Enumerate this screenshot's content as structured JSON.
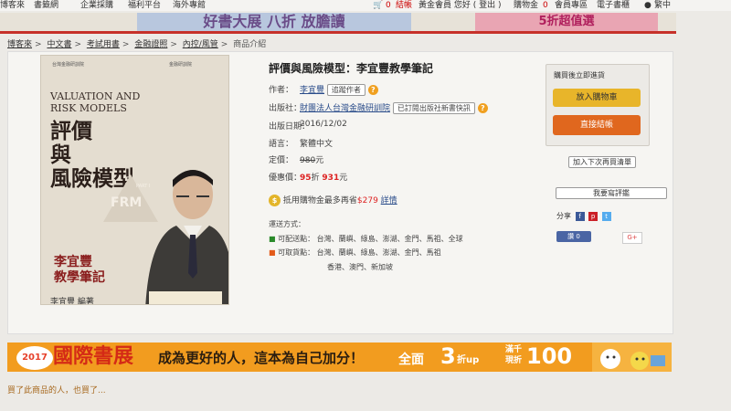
{
  "topnav": {
    "left": [
      "博客來",
      "書籤網",
      "企業採購",
      "福利平台",
      "海外專館"
    ],
    "checkout_count": "0",
    "checkout_label": "結帳",
    "greeting": "黃金會員 您好 ( 登出 )",
    "cart_label": "購物金",
    "cart_count": "0",
    "member": "會員專區",
    "ebook": "電子書櫃",
    "lang": "繁中"
  },
  "banner": {
    "center": "好書大展 八折 放膽讀",
    "right": "5折超值選"
  },
  "breadcrumb": [
    "博客來",
    "中文書",
    "考試用書",
    "金融證照",
    "內控/風管",
    "商品介紹"
  ],
  "cover": {
    "publisher_logo": "台灣金融研訓院",
    "publisher_logo2": "金融研訓院",
    "en_title_1": "VALUATION AND",
    "en_title_2": "RISK MODELS",
    "zh_title_1": "評價",
    "zh_title_2": "與",
    "zh_title_3": "風險模型",
    "part": "PART I",
    "frm": "FRM",
    "author_1": "李宜豐",
    "author_2": "教學筆記",
    "sign": "李宜豐 編著"
  },
  "product": {
    "title": "評價與風險模型：李宜豐教學筆記",
    "author_label": "作者：",
    "author": "李宜豐",
    "follow_label": "追蹤作者",
    "publisher_label": "出版社：",
    "publisher": "財團法人台灣金融研訓院",
    "subscribe_label": "已訂閱出版社新書快訊",
    "date_label": "出版日期：",
    "date": "2016/12/02",
    "lang_label": "語言：",
    "lang": "繁體中文",
    "list_price_label": "定價：",
    "list_price": "980",
    "yuan": "元",
    "sale_label": "優惠價：",
    "discount": "95",
    "zhe": "折",
    "sale_price": "931",
    "promo_text": "抵用購物金最多再省",
    "promo_amount": "$279",
    "promo_details": "詳情",
    "shipping_label": "運送方式：",
    "ship1_label": "可配送點：",
    "ship1_value": "台灣、蘭嶼、綠島、澎湖、金門、馬祖、全球",
    "ship2_label": "可取貨點：",
    "ship2_value": "台灣、蘭嶼、綠島、澎湖、金門、馬祖",
    "ship2_value2": "香港、澳門、新加坡"
  },
  "buybox": {
    "header": "購買後立即進貨",
    "add_cart": "放入購物車",
    "checkout": "直接結帳",
    "wishlist": "加入下次再買清單",
    "review": "我要寫評鑑"
  },
  "social": {
    "share_label": "分享",
    "f": "f",
    "p": "p",
    "t": "t",
    "like": "讚 0",
    "gplus": "G+"
  },
  "expo": {
    "badge": "2017",
    "big": "國際書展",
    "slogan": "成為更好的人，這本為自己加分！",
    "full": "全面",
    "three": "3",
    "off": "折up",
    "man": "滿千現折",
    "hundred": "100"
  },
  "bought": "買了此商品的人，也買了..."
}
